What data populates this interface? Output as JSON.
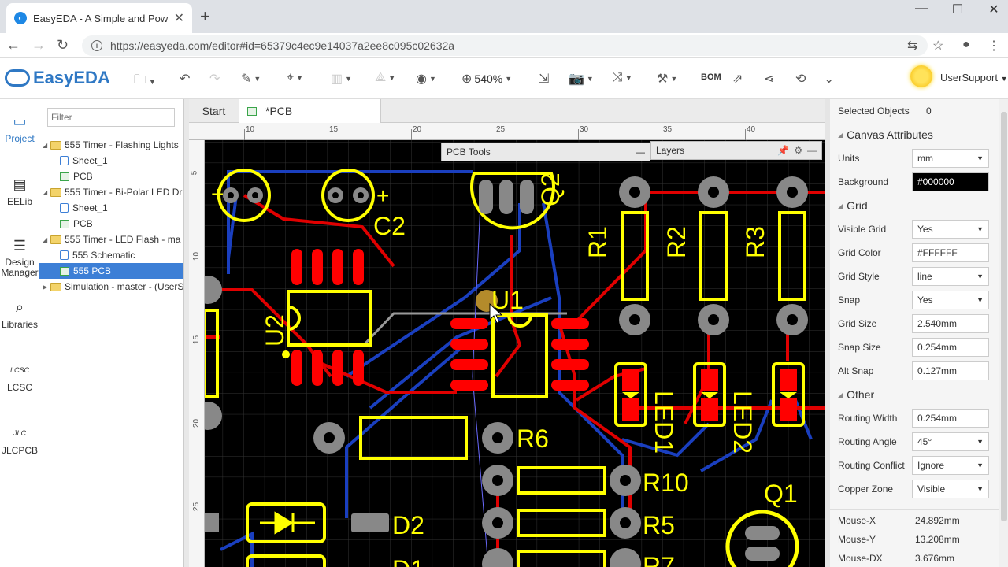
{
  "browser": {
    "tab_title": "EasyEDA - A Simple and Powe",
    "url": "https://easyeda.com/editor#id=65379c4ec9e14037a2ee8c095c02632a"
  },
  "toolbar": {
    "logo": "EasyEDA",
    "zoom": "540%",
    "bom": "BOM",
    "user": "UserSupport"
  },
  "leftnav": [
    {
      "label": "Project",
      "icon": "project-icon"
    },
    {
      "label": "EELib",
      "icon": "chip-icon"
    },
    {
      "label": "Design Manager",
      "icon": "list-icon"
    },
    {
      "label": "Libraries",
      "icon": "libraries-icon"
    },
    {
      "label": "LCSC",
      "icon": "lcsc-icon"
    },
    {
      "label": "JLCPCB",
      "icon": "jlcpcb-icon"
    }
  ],
  "tree": {
    "filter_placeholder": "Filter",
    "items": [
      {
        "label": "555 Timer - Flashing Lights",
        "type": "folder",
        "level": 0
      },
      {
        "label": "Sheet_1",
        "type": "sheet",
        "level": 1
      },
      {
        "label": "PCB",
        "type": "pcb",
        "level": 1
      },
      {
        "label": "555 Timer - Bi-Polar LED Dr",
        "type": "folder",
        "level": 0
      },
      {
        "label": "Sheet_1",
        "type": "sheet",
        "level": 1
      },
      {
        "label": "PCB",
        "type": "pcb",
        "level": 1
      },
      {
        "label": "555 Timer - LED Flash - ma",
        "type": "folder",
        "level": 0
      },
      {
        "label": "555 Schematic",
        "type": "sheet",
        "level": 1
      },
      {
        "label": "555 PCB",
        "type": "pcb",
        "level": 1,
        "selected": true
      },
      {
        "label": "Simulation - master - (UserS",
        "type": "folder",
        "level": 0,
        "collapsed": true
      }
    ]
  },
  "doctabs": {
    "start": "Start",
    "pcb": "*PCB"
  },
  "ruler": {
    "top": [
      "10",
      "15",
      "20",
      "25",
      "30",
      "35",
      "40"
    ],
    "left": [
      "5",
      "10",
      "15",
      "20",
      "25"
    ]
  },
  "canvas": {
    "pcb_tools_title": "PCB Tools",
    "layers_title": "Layers",
    "labels": [
      "C2",
      "Q2",
      "R1",
      "R2",
      "R3",
      "U1",
      "U2",
      "LED1",
      "LED2",
      "R6",
      "R10",
      "R5",
      "D2",
      "Q1",
      "R7",
      "D1"
    ]
  },
  "properties": {
    "selected_label": "Selected Objects",
    "selected_count": "0",
    "canvas_section": "Canvas Attributes",
    "units_label": "Units",
    "units": "mm",
    "background_label": "Background",
    "background": "#000000",
    "grid_section": "Grid",
    "visible_grid_label": "Visible Grid",
    "visible_grid": "Yes",
    "grid_color_label": "Grid Color",
    "grid_color": "#FFFFFF",
    "grid_style_label": "Grid Style",
    "grid_style": "line",
    "snap_label": "Snap",
    "snap": "Yes",
    "grid_size_label": "Grid Size",
    "grid_size": "2.540mm",
    "snap_size_label": "Snap Size",
    "snap_size": "0.254mm",
    "alt_snap_label": "Alt Snap",
    "alt_snap": "0.127mm",
    "other_section": "Other",
    "routing_width_label": "Routing Width",
    "routing_width": "0.254mm",
    "routing_angle_label": "Routing Angle",
    "routing_angle": "45°",
    "routing_conflict_label": "Routing Conflict",
    "routing_conflict": "Ignore",
    "copper_zone_label": "Copper Zone",
    "copper_zone": "Visible"
  },
  "mouse": {
    "x_label": "Mouse-X",
    "x": "24.892mm",
    "y_label": "Mouse-Y",
    "y": "13.208mm",
    "dx_label": "Mouse-DX",
    "dx": "3.676mm"
  },
  "colors": {
    "accent": "#2f78c4",
    "pad": "#ff0000",
    "silk": "#ffff00",
    "track_blue": "#1a3fbf"
  }
}
